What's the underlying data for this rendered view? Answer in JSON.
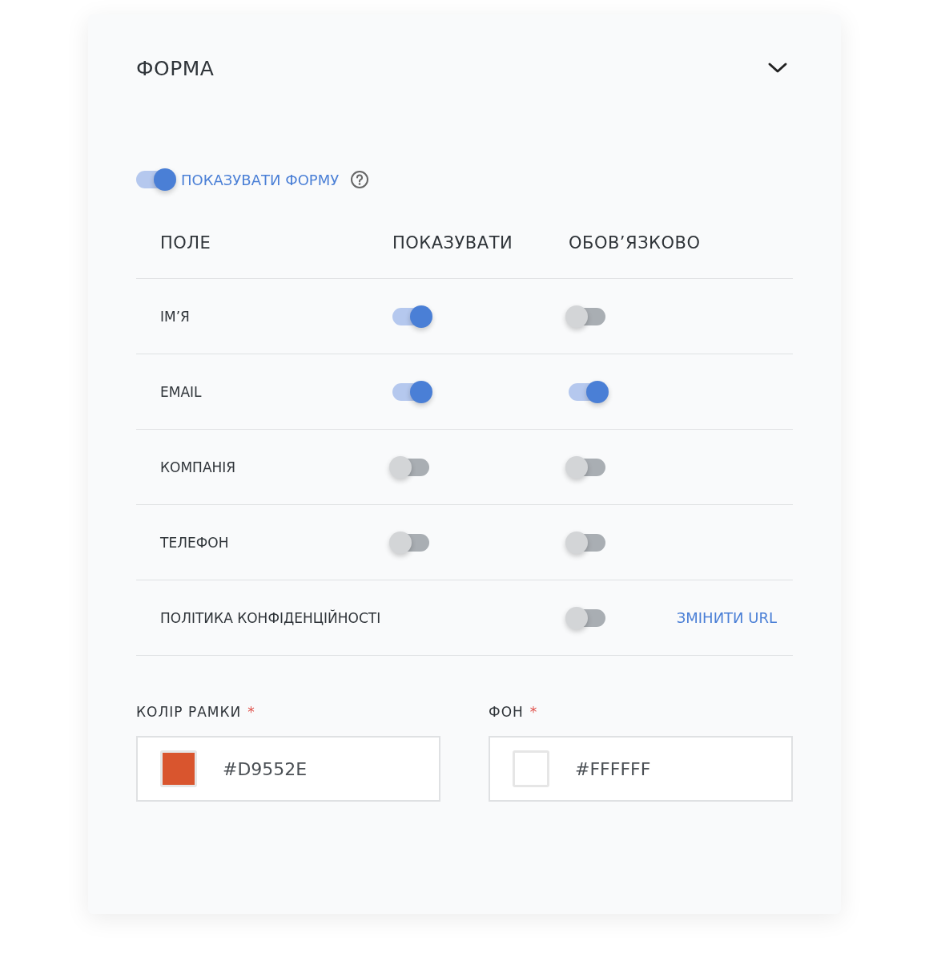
{
  "panel": {
    "title": "ФОРМА",
    "expanded": true
  },
  "show_form": {
    "label": "ПОКАЗУВАТИ ФОРМУ",
    "on": true
  },
  "table": {
    "columns": [
      "ПОЛЕ",
      "ПОКАЗУВАТИ",
      "ОБОВ’ЯЗКОВО"
    ],
    "rows": [
      {
        "name": "ІМ’Я",
        "show": {
          "on": true
        },
        "required": {
          "on": false
        }
      },
      {
        "name": "EMAIL",
        "show": {
          "on": true
        },
        "required": {
          "on": true
        }
      },
      {
        "name": "КОМПАНІЯ",
        "show": {
          "on": false
        },
        "required": {
          "on": false
        }
      },
      {
        "name": "ТЕЛЕФОН",
        "show": {
          "on": false
        },
        "required": {
          "on": false
        }
      },
      {
        "name": "ПОЛІТИКА КОНФІДЕНЦІЙНОСТІ",
        "required": {
          "on": false
        },
        "link": "ЗМІНИТИ URL"
      }
    ]
  },
  "color_fields": [
    {
      "label": "КОЛІР РАМКИ",
      "required_mark": "*",
      "value": "#D9552E",
      "color": "#d9552e"
    },
    {
      "label": "ФОН",
      "required_mark": "*",
      "value": "#FFFFFF",
      "color": "#ffffff"
    }
  ]
}
